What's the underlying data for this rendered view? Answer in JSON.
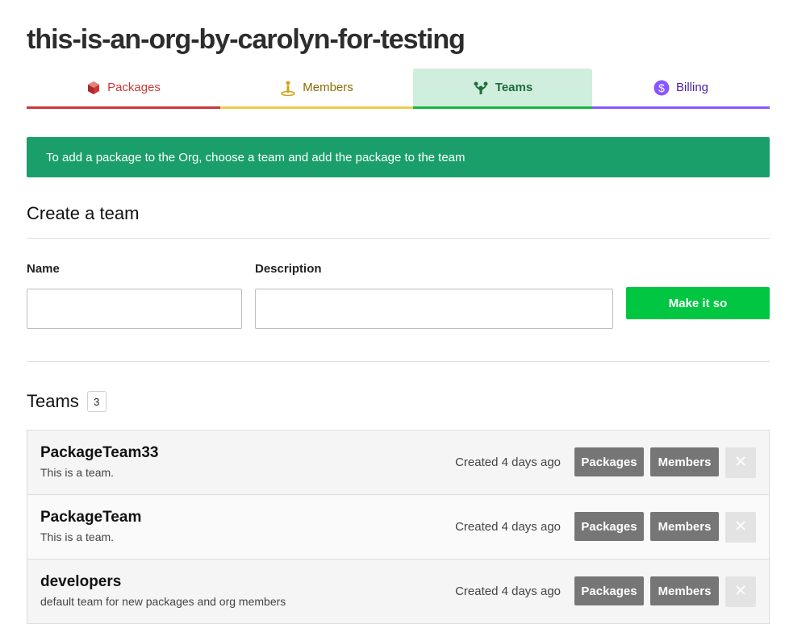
{
  "org": {
    "title": "this-is-an-org-by-carolyn-for-testing"
  },
  "tabs": [
    {
      "label": "Packages",
      "icon": "package-icon",
      "color": "#cb3837"
    },
    {
      "label": "Members",
      "icon": "member-icon",
      "color": "#8a6d00"
    },
    {
      "label": "Teams",
      "icon": "teams-icon",
      "color": "#1e6b3c",
      "active": true
    },
    {
      "label": "Billing",
      "icon": "dollar-icon",
      "color": "#8956ff"
    }
  ],
  "notice": {
    "text": "To add a package to the Org, choose a team and add the package to the team",
    "color": "#1a9f6b"
  },
  "create_team": {
    "title": "Create a team",
    "name_label": "Name",
    "name_value": "",
    "description_label": "Description",
    "description_value": "",
    "submit_label": "Make it so"
  },
  "teams": {
    "title": "Teams",
    "count": "3",
    "items": [
      {
        "name": "PackageTeam33",
        "description": "This is a team.",
        "created": "Created 4 days ago",
        "packages_label": "Packages",
        "members_label": "Members",
        "delete_icon": "close-icon"
      },
      {
        "name": "PackageTeam",
        "description": "This is a team.",
        "created": "Created 4 days ago",
        "packages_label": "Packages",
        "members_label": "Members",
        "delete_icon": "close-icon"
      },
      {
        "name": "developers",
        "description": "default team for new packages and org members",
        "created": "Created 4 days ago",
        "packages_label": "Packages",
        "members_label": "Members",
        "delete_icon": "close-icon"
      }
    ]
  }
}
